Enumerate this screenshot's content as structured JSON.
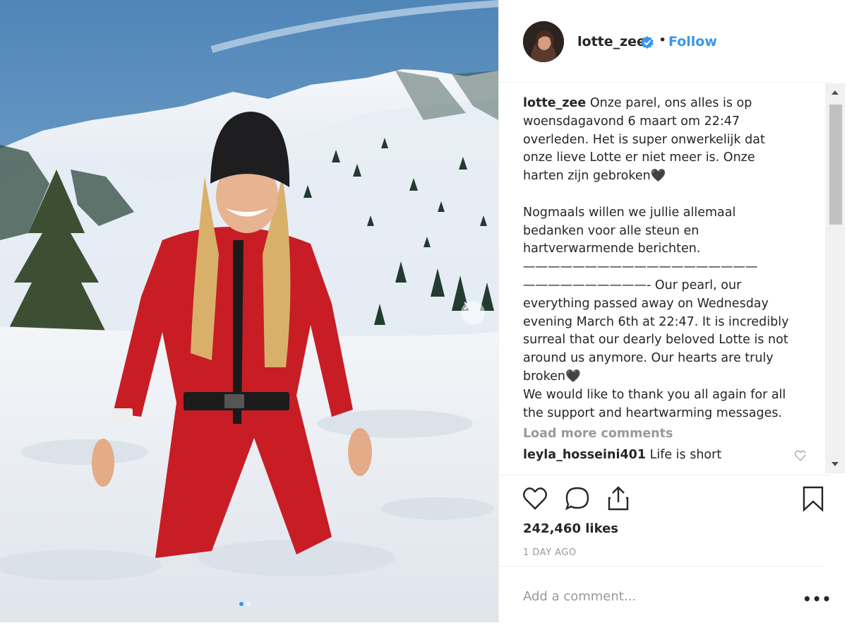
{
  "post": {
    "author": {
      "username": "lotte_zee",
      "verified": true
    },
    "follow_label": "Follow",
    "separator": "•",
    "caption": {
      "username": "lotte_zee",
      "text": " Onze parel, ons alles is op\nwoensdagavond 6 maart om 22:47\noverleden. Het is super onwerkelijk dat\nonze lieve Lotte er niet meer is. Onze\nharten zijn gebroken🖤\n\nNogmaals willen we jullie allemaal\nbedanken voor alle steun en\nhartverwarmende berichten.\n———————————————————\n——————————- Our pearl, our\neverything passed away on Wednesday\nevening March 6th at 22:47. It is incredibly\nsurreal that our dearly beloved Lotte is not\naround us anymore. Our hearts are truly\nbroken🖤\nWe would like to thank you all again for all\nthe support and heartwarming messages."
    },
    "load_more_label": "Load more comments",
    "comments": [
      {
        "username": "leyla_hosseini401",
        "text": " Life is short"
      }
    ],
    "likes": "242,460 likes",
    "timestamp": "1 DAY AGO",
    "add_comment_placeholder": "Add a comment...",
    "more_options": "•••",
    "carousel": {
      "slides": 2,
      "active": 1
    }
  },
  "icons": {
    "verified": "verified-badge-icon",
    "like": "heart-icon",
    "comment": "comment-bubble-icon",
    "share": "share-icon",
    "save": "bookmark-icon",
    "next": "chevron-right-icon"
  },
  "colors": {
    "accent": "#3897f0",
    "text": "#262626",
    "muted": "#999999",
    "border": "#efefef"
  }
}
